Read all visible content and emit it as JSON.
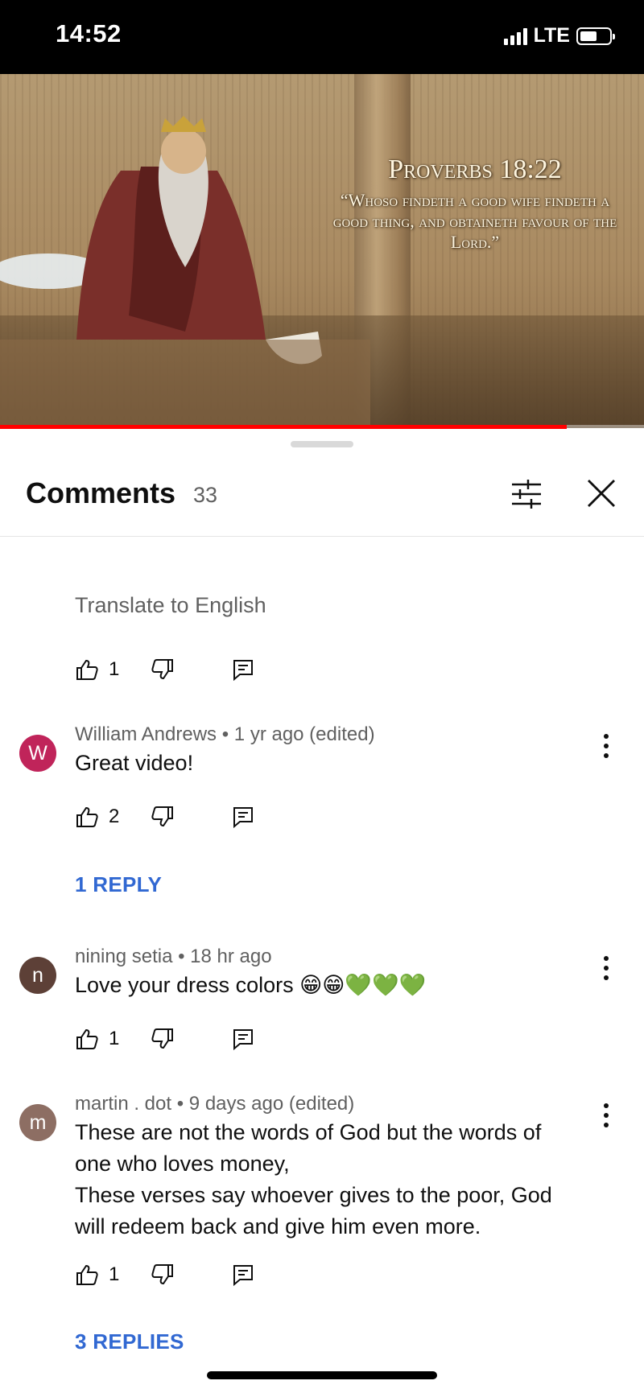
{
  "status_bar": {
    "time": "14:52",
    "network": "LTE"
  },
  "video": {
    "caption_reference": "Proverbs 18:22",
    "caption_verse": "“Whoso findeth a good wife findeth a good thing, and obtaineth favour of the Lord.”",
    "progress": 0.88,
    "progress_color": "#ff0000"
  },
  "comments_panel": {
    "title": "Comments",
    "count": "33",
    "filter_icon": "sliders-icon",
    "close_icon": "close-icon"
  },
  "partial_comment": {
    "translate_label": "Translate to English",
    "like_count": "1"
  },
  "comments": [
    {
      "avatar_letter": "W",
      "avatar_color": "#c0245a",
      "author": "William Andrews",
      "time": "1 yr ago (edited)",
      "text": "Great video!",
      "likes": "2",
      "replies_label": "1 REPLY"
    },
    {
      "avatar_letter": "n",
      "avatar_color": "#5d4037",
      "author": "nining setia",
      "time": "18 hr ago",
      "text": "Love your dress colors 😁😁💚💚💚",
      "likes": "1"
    },
    {
      "avatar_letter": "m",
      "avatar_color": "#8d6e63",
      "author": "martin . dot",
      "time": "9 days ago (edited)",
      "text_line1": "These are not the words of God but the words of one who loves money,",
      "text_line2": "These verses say whoever gives to the poor, God will redeem back and give him even more.",
      "likes": "1",
      "replies_label": "3 REPLIES"
    }
  ],
  "accent_color": "#3168d2"
}
